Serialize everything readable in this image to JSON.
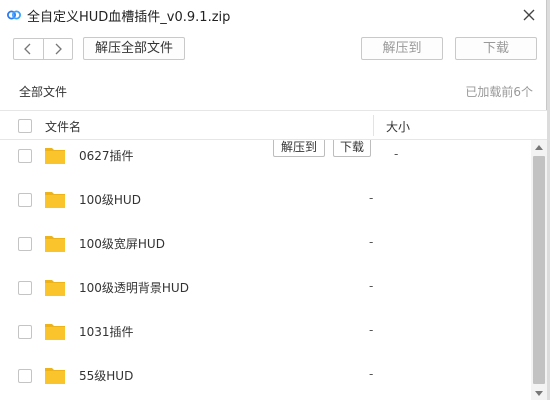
{
  "window": {
    "title": "全自定义HUD血槽插件_v0.9.1.zip",
    "icons": {
      "app": "baidu-netdisk-icon",
      "close": "close-icon"
    }
  },
  "toolbar": {
    "back_icon": "chevron-left-icon",
    "forward_icon": "chevron-right-icon",
    "extract_all_label": "解压全部文件",
    "extract_to_label": "解压到",
    "download_label": "下载"
  },
  "breadcrumb": {
    "root": "全部文件",
    "loaded_status": "已加载前6个"
  },
  "table": {
    "columns": {
      "name": "文件名",
      "size": "大小"
    },
    "rows": [
      {
        "name": "0627插件",
        "size": "-",
        "type": "folder",
        "hovered": true
      },
      {
        "name": "100级HUD",
        "size": "-",
        "type": "folder"
      },
      {
        "name": "100级宽屏HUD",
        "size": "-",
        "type": "folder"
      },
      {
        "name": "100级透明背景HUD",
        "size": "-",
        "type": "folder"
      },
      {
        "name": "1031插件",
        "size": "-",
        "type": "folder"
      },
      {
        "name": "55级HUD",
        "size": "-",
        "type": "folder"
      }
    ],
    "row_actions": {
      "extract_to": "解压到",
      "download": "下载"
    }
  },
  "colors": {
    "folder": "#f9c42c",
    "folder_tab": "#eeb318",
    "app_icon": "#2e7bf0",
    "disabled_text": "#999999"
  }
}
